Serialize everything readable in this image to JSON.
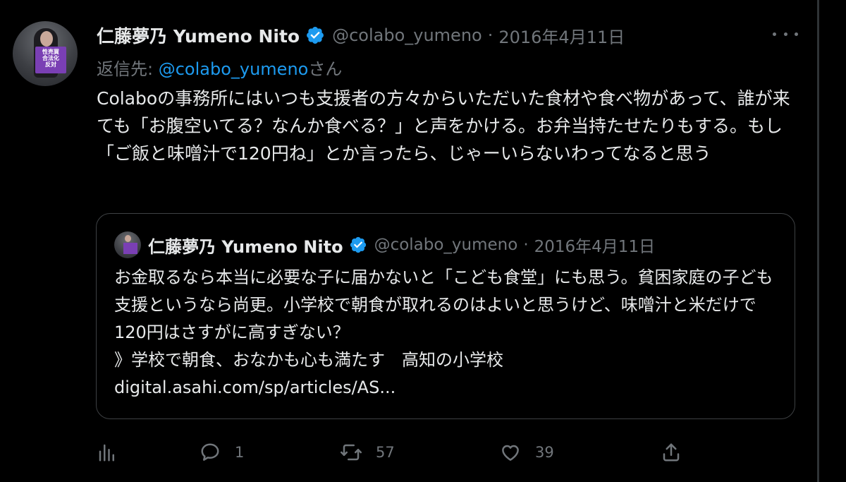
{
  "tweet": {
    "display_name": "仁藤夢乃 Yumeno Nito",
    "handle": "@colabo_yumeno",
    "separator": "·",
    "date": "2016年4月11日",
    "reply_prefix": "返信先: ",
    "reply_mention": "@colabo_yumeno",
    "reply_suffix": "さん",
    "body": "Colaboの事務所にはいつも支援者の方々からいただいた食材や食べ物があって、誰が来ても「お腹空いてる？なんか食べる？」と声をかける。お弁当持たせたりもする。もし「ご飯と味噌汁で120円ね」とか言ったら、じゃーいらないわってなると思う"
  },
  "avatar_sign": [
    "性売買",
    "合法化",
    "反対"
  ],
  "quote": {
    "display_name": "仁藤夢乃 Yumeno Nito",
    "handle": "@colabo_yumeno",
    "separator": "·",
    "date": "2016年4月11日",
    "body": "お金取るなら本当に必要な子に届かないと「こども食堂」にも思う。貧困家庭の子ども支援というなら尚更。小学校で朝食が取れるのはよいと思うけど、味噌汁と米だけで120円はさすがに高すぎない？",
    "link_title": "》学校で朝食、おなかも心も満たす　高知の小学校",
    "link_url": "digital.asahi.com/sp/articles/AS..."
  },
  "actions": {
    "analytics_icon": "analytics-icon",
    "reply_icon": "reply-icon",
    "reply_count": "1",
    "retweet_icon": "retweet-icon",
    "retweet_count": "57",
    "like_icon": "like-icon",
    "like_count": "39",
    "share_icon": "share-icon"
  },
  "colors": {
    "background": "#000000",
    "text": "#e7e9ea",
    "secondary": "#71767b",
    "accent": "#1d9bf0",
    "border": "#3e4144"
  }
}
